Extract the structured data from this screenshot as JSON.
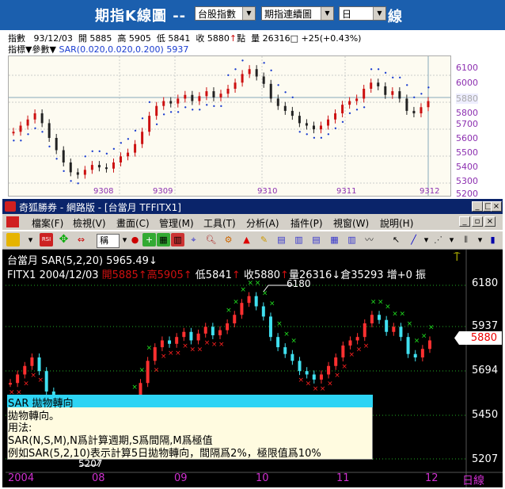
{
  "header": {
    "title": "期指K線圖 --",
    "select1": "台股指數",
    "select2": "期指連續圖",
    "select3": "日",
    "suffix": "線"
  },
  "top_chart": {
    "info1_label": "指數",
    "info1_date": "93/12/03",
    "info1_open_label": "開",
    "info1_open": "5885",
    "info1_high_label": "高",
    "info1_high": "5905",
    "info1_low_label": "低",
    "info1_low": "5841",
    "info1_close_label": "收",
    "info1_close": "5880",
    "info1_unit": "點",
    "info1_volume_label": "量",
    "info1_volume": "26316",
    "info1_change": "+25(+0.43%)",
    "indicator_label": "指標",
    "param_label": "參數",
    "sar_text": "SAR(0.020,0.020,0.200)",
    "sar_value": "5937",
    "y_ticks": [
      "6100",
      "6000",
      "5900",
      "5800",
      "5700",
      "5600",
      "5500",
      "5400",
      "5300",
      "5200"
    ],
    "current_value": "5880",
    "x_ticks": [
      "9308",
      "9309",
      "9310",
      "9311",
      "9312"
    ]
  },
  "app": {
    "title": "奇狐勝券 - 網路版 - [台當月 TFFITX1]",
    "menus": [
      "檔案(F)",
      "檢視(V)",
      "畫面(C)",
      "管理(M)",
      "工具(T)",
      "分析(A)",
      "插件(P)",
      "視窗(W)",
      "說明(H)"
    ],
    "toolbar_select": "稱"
  },
  "main_chart": {
    "title": "台當月 SAR(5,2,20) 5965.49",
    "info_symbol": "FITX1",
    "info_date": "2004/12/03",
    "open": "開5885",
    "high": "高5905",
    "low": "低5841",
    "close": "收5880",
    "volume": "量26316",
    "oi": "倉35293",
    "inc": "增+0",
    "amp": "振",
    "high_label": "6180",
    "low_label": "5207",
    "y_ticks": [
      "6180",
      "5937",
      "5694",
      "5450",
      "5207"
    ],
    "current_value": "5880",
    "x_ticks": [
      "2004",
      "08",
      "09",
      "10",
      "11",
      "12"
    ],
    "x_unit": "日線"
  },
  "tooltip": {
    "head": "SAR 拋物轉向",
    "line1": "拋物轉向。",
    "line2": "用法:",
    "line3": "SAR(N,S,M),N爲計算週期,S爲間隔,M爲極值",
    "line4": "例如SAR(5,2,10)表示計算5日拋物轉向，間隔爲2%，極限值爲10%"
  },
  "colors": {
    "header_bg": "#1b5fae",
    "titlebar": "#0a246a",
    "up_candle": "#ff3030",
    "down_candle": "#40e0f0",
    "sar_up": "#ff2020",
    "sar_down": "#20e020",
    "sar_top": "#1a3ccf"
  }
}
